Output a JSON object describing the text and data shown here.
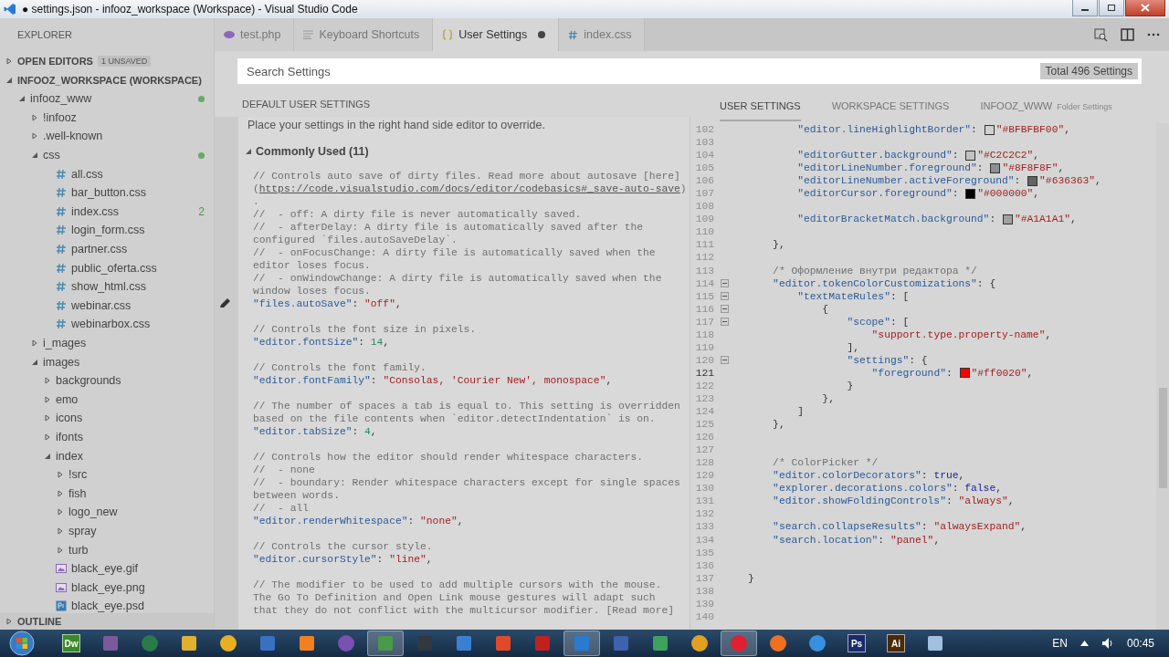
{
  "window": {
    "title": "● settings.json - infooz_workspace (Workspace) - Visual Studio Code"
  },
  "sidebar": {
    "title": "EXPLORER",
    "sections": [
      {
        "label": "OPEN EDITORS",
        "expanded": false,
        "badge": "1 UNSAVED"
      },
      {
        "label": "INFOOZ_WORKSPACE (WORKSPACE)",
        "expanded": true
      }
    ],
    "tree": [
      {
        "label": "infooz_www",
        "kind": "folder",
        "expanded": true,
        "modified": true,
        "children": [
          {
            "label": "!infooz",
            "kind": "folder",
            "expanded": false
          },
          {
            "label": ".well-known",
            "kind": "folder",
            "expanded": false
          },
          {
            "label": "css",
            "kind": "folder",
            "expanded": true,
            "modified": true,
            "children": [
              {
                "label": "all.css",
                "kind": "css"
              },
              {
                "label": "bar_button.css",
                "kind": "css"
              },
              {
                "label": "index.css",
                "kind": "css",
                "badge": "2"
              },
              {
                "label": "login_form.css",
                "kind": "css"
              },
              {
                "label": "partner.css",
                "kind": "css"
              },
              {
                "label": "public_oferta.css",
                "kind": "css"
              },
              {
                "label": "show_html.css",
                "kind": "css"
              },
              {
                "label": "webinar.css",
                "kind": "css"
              },
              {
                "label": "webinarbox.css",
                "kind": "css"
              }
            ]
          },
          {
            "label": "i_mages",
            "kind": "folder",
            "expanded": false
          },
          {
            "label": "images",
            "kind": "folder",
            "expanded": true,
            "children": [
              {
                "label": "backgrounds",
                "kind": "folder",
                "expanded": false
              },
              {
                "label": "emo",
                "kind": "folder",
                "expanded": false
              },
              {
                "label": "icons",
                "kind": "folder",
                "expanded": false
              },
              {
                "label": "ifonts",
                "kind": "folder",
                "expanded": false
              },
              {
                "label": "index",
                "kind": "folder",
                "expanded": true,
                "children": [
                  {
                    "label": "!src",
                    "kind": "folder",
                    "expanded": false
                  },
                  {
                    "label": "fish",
                    "kind": "folder",
                    "expanded": false
                  },
                  {
                    "label": "logo_new",
                    "kind": "folder",
                    "expanded": false
                  },
                  {
                    "label": "spray",
                    "kind": "folder",
                    "expanded": false
                  },
                  {
                    "label": "turb",
                    "kind": "folder",
                    "expanded": false
                  }
                ]
              },
              {
                "label": "black_eye.gif",
                "kind": "image"
              },
              {
                "label": "black_eye.png",
                "kind": "image"
              },
              {
                "label": "black_eye.psd",
                "kind": "psd"
              }
            ]
          }
        ]
      }
    ],
    "footer": {
      "label": "OUTLINE",
      "expanded": false
    }
  },
  "tabs": [
    {
      "label": "test.php",
      "kind": "php",
      "selected": false
    },
    {
      "label": "Keyboard Shortcuts",
      "kind": "shortcuts",
      "selected": false
    },
    {
      "label": "User Settings",
      "kind": "json",
      "selected": true,
      "dirty": true
    },
    {
      "label": "index.css",
      "kind": "css",
      "selected": false
    }
  ],
  "search": {
    "placeholder": "Search Settings",
    "count": "Total 496 Settings"
  },
  "default_pane": {
    "header": "DEFAULT USER SETTINGS",
    "note": "Place your settings in the right hand side editor to override.",
    "group": {
      "label": "Commonly Used (11)",
      "expanded": true
    },
    "blocks": [
      {
        "lines": [
          {
            "tokens": [
              {
                "kind": "comment",
                "text": "// Controls auto save of dirty files. Read more about autosave [here]"
              }
            ]
          },
          {
            "tokens": [
              {
                "kind": "comment",
                "text": "("
              },
              {
                "kind": "link",
                "text": "https://code.visualstudio.com/docs/editor/codebasics#_save-auto-save"
              },
              {
                "kind": "comment",
                "text": ")"
              }
            ]
          },
          {
            "tokens": [
              {
                "kind": "comment",
                "text": "."
              }
            ]
          },
          {
            "tokens": [
              {
                "kind": "comment",
                "text": "//  - off: A dirty file is never automatically saved."
              }
            ]
          },
          {
            "tokens": [
              {
                "kind": "comment",
                "text": "//  - afterDelay: A dirty file is automatically saved after the"
              }
            ]
          },
          {
            "tokens": [
              {
                "kind": "comment",
                "text": "configured `files.autoSaveDelay`."
              }
            ]
          },
          {
            "tokens": [
              {
                "kind": "comment",
                "text": "//  - onFocusChange: A dirty file is automatically saved when the"
              }
            ]
          },
          {
            "tokens": [
              {
                "kind": "comment",
                "text": "editor loses focus."
              }
            ]
          },
          {
            "tokens": [
              {
                "kind": "comment",
                "text": "//  - onWindowChange: A dirty file is automatically saved when the"
              }
            ]
          },
          {
            "tokens": [
              {
                "kind": "comment",
                "text": "window loses focus."
              }
            ]
          },
          {
            "pencil": true,
            "tokens": [
              {
                "kind": "key",
                "text": "\"files.autoSave\""
              },
              {
                "kind": "punct",
                "text": ": "
              },
              {
                "kind": "string",
                "text": "\"off\""
              },
              {
                "kind": "punct",
                "text": ","
              }
            ]
          }
        ]
      },
      {
        "lines": [
          {
            "tokens": [
              {
                "kind": "comment",
                "text": "// Controls the font size in pixels."
              }
            ]
          },
          {
            "tokens": [
              {
                "kind": "key",
                "text": "\"editor.fontSize\""
              },
              {
                "kind": "punct",
                "text": ": "
              },
              {
                "kind": "number",
                "text": "14"
              },
              {
                "kind": "punct",
                "text": ","
              }
            ]
          }
        ]
      },
      {
        "lines": [
          {
            "tokens": [
              {
                "kind": "comment",
                "text": "// Controls the font family."
              }
            ]
          },
          {
            "tokens": [
              {
                "kind": "key",
                "text": "\"editor.fontFamily\""
              },
              {
                "kind": "punct",
                "text": ": "
              },
              {
                "kind": "string",
                "text": "\"Consolas, 'Courier New', monospace\""
              },
              {
                "kind": "punct",
                "text": ","
              }
            ]
          }
        ]
      },
      {
        "lines": [
          {
            "tokens": [
              {
                "kind": "comment",
                "text": "// The number of spaces a tab is equal to. This setting is overridden"
              }
            ]
          },
          {
            "tokens": [
              {
                "kind": "comment",
                "text": "based on the file contents when `editor.detectIndentation` is on."
              }
            ]
          },
          {
            "tokens": [
              {
                "kind": "key",
                "text": "\"editor.tabSize\""
              },
              {
                "kind": "punct",
                "text": ": "
              },
              {
                "kind": "number",
                "text": "4"
              },
              {
                "kind": "punct",
                "text": ","
              }
            ]
          }
        ]
      },
      {
        "lines": [
          {
            "tokens": [
              {
                "kind": "comment",
                "text": "// Controls how the editor should render whitespace characters."
              }
            ]
          },
          {
            "tokens": [
              {
                "kind": "comment",
                "text": "//  - none"
              }
            ]
          },
          {
            "tokens": [
              {
                "kind": "comment",
                "text": "//  - boundary: Render whitespace characters except for single spaces"
              }
            ]
          },
          {
            "tokens": [
              {
                "kind": "comment",
                "text": "between words."
              }
            ]
          },
          {
            "tokens": [
              {
                "kind": "comment",
                "text": "//  - all"
              }
            ]
          },
          {
            "tokens": [
              {
                "kind": "key",
                "text": "\"editor.renderWhitespace\""
              },
              {
                "kind": "punct",
                "text": ": "
              },
              {
                "kind": "string",
                "text": "\"none\""
              },
              {
                "kind": "punct",
                "text": ","
              }
            ]
          }
        ]
      },
      {
        "lines": [
          {
            "tokens": [
              {
                "kind": "comment",
                "text": "// Controls the cursor style."
              }
            ]
          },
          {
            "tokens": [
              {
                "kind": "key",
                "text": "\"editor.cursorStyle\""
              },
              {
                "kind": "punct",
                "text": ": "
              },
              {
                "kind": "string",
                "text": "\"line\""
              },
              {
                "kind": "punct",
                "text": ","
              }
            ]
          }
        ]
      },
      {
        "lines": [
          {
            "tokens": [
              {
                "kind": "comment",
                "text": "// The modifier to be used to add multiple cursors with the mouse."
              }
            ]
          },
          {
            "tokens": [
              {
                "kind": "comment",
                "text": "The Go To Definition and Open Link mouse gestures will adapt such"
              }
            ]
          },
          {
            "tokens": [
              {
                "kind": "comment",
                "text": "that they do not conflict with the multicursor modifier. [Read more]"
              }
            ]
          }
        ]
      }
    ]
  },
  "user_pane": {
    "tabs": [
      {
        "label": "USER SETTINGS",
        "selected": true
      },
      {
        "label": "WORKSPACE SETTINGS",
        "selected": false
      },
      {
        "label": "INFOOZ_WWW",
        "sublabel": "Folder Settings",
        "selected": false
      }
    ],
    "lines": [
      {
        "number": "102",
        "tokens": [
          {
            "kind": "key",
            "text": "        \"editor.lineHighlightBorder\""
          },
          {
            "kind": "punct",
            "text": ": "
          },
          {
            "kind": "swatch",
            "color": "#d0d0d0"
          },
          {
            "kind": "string",
            "text": "\"#BFBFBF00\""
          },
          {
            "kind": "punct",
            "text": ","
          }
        ]
      },
      {
        "number": "103"
      },
      {
        "number": "104",
        "tokens": [
          {
            "kind": "key",
            "text": "        \"editorGutter.background\""
          },
          {
            "kind": "punct",
            "text": ": "
          },
          {
            "kind": "swatch",
            "color": "#c2c2c2"
          },
          {
            "kind": "string",
            "text": "\"#C2C2C2\""
          },
          {
            "kind": "punct",
            "text": ","
          }
        ]
      },
      {
        "number": "105",
        "tokens": [
          {
            "kind": "key",
            "text": "        \"editorLineNumber.foreground\""
          },
          {
            "kind": "punct",
            "text": ": "
          },
          {
            "kind": "swatch",
            "color": "#8f8f8f"
          },
          {
            "kind": "string",
            "text": "\"#8F8F8F\""
          },
          {
            "kind": "punct",
            "text": ","
          }
        ]
      },
      {
        "number": "106",
        "tokens": [
          {
            "kind": "key",
            "text": "        \"editorLineNumber.activeForeground\""
          },
          {
            "kind": "punct",
            "text": ": "
          },
          {
            "kind": "swatch",
            "color": "#636363"
          },
          {
            "kind": "string",
            "text": "\"#636363\""
          },
          {
            "kind": "punct",
            "text": ","
          }
        ]
      },
      {
        "number": "107",
        "tokens": [
          {
            "kind": "key",
            "text": "        \"editorCursor.foreground\""
          },
          {
            "kind": "punct",
            "text": ": "
          },
          {
            "kind": "swatch",
            "color": "#000000"
          },
          {
            "kind": "string",
            "text": "\"#000000\""
          },
          {
            "kind": "punct",
            "text": ","
          }
        ]
      },
      {
        "number": "108"
      },
      {
        "number": "109",
        "tokens": [
          {
            "kind": "key",
            "text": "        \"editorBracketMatch.background\""
          },
          {
            "kind": "punct",
            "text": ": "
          },
          {
            "kind": "swatch",
            "color": "#a1a1a1"
          },
          {
            "kind": "string",
            "text": "\"#A1A1A1\""
          },
          {
            "kind": "punct",
            "text": ","
          }
        ]
      },
      {
        "number": "110"
      },
      {
        "number": "111",
        "tokens": [
          {
            "kind": "punct",
            "text": "    },"
          }
        ]
      },
      {
        "number": "112"
      },
      {
        "number": "113",
        "tokens": [
          {
            "kind": "comment",
            "text": "    /* Оформление внутри редактора */"
          }
        ]
      },
      {
        "number": "114",
        "fold": true,
        "tokens": [
          {
            "kind": "key",
            "text": "    \"editor.tokenColorCustomizations\""
          },
          {
            "kind": "punct",
            "text": ": {"
          }
        ]
      },
      {
        "number": "115",
        "fold": true,
        "tokens": [
          {
            "kind": "key",
            "text": "        \"textMateRules\""
          },
          {
            "kind": "punct",
            "text": ": ["
          }
        ]
      },
      {
        "number": "116",
        "fold": true,
        "tokens": [
          {
            "kind": "punct",
            "text": "            {"
          }
        ]
      },
      {
        "number": "117",
        "fold": true,
        "tokens": [
          {
            "kind": "key",
            "text": "                \"scope\""
          },
          {
            "kind": "punct",
            "text": ": ["
          }
        ]
      },
      {
        "number": "118",
        "tokens": [
          {
            "kind": "string",
            "text": "                    \"support.type.property-name\""
          },
          {
            "kind": "punct",
            "text": ","
          }
        ]
      },
      {
        "number": "119",
        "tokens": [
          {
            "kind": "punct",
            "text": "                ],"
          }
        ]
      },
      {
        "number": "120",
        "fold": true,
        "tokens": [
          {
            "kind": "key",
            "text": "                \"settings\""
          },
          {
            "kind": "punct",
            "text": ": {"
          }
        ]
      },
      {
        "number": "121",
        "active": true,
        "tokens": [
          {
            "kind": "key",
            "text": "                    \"foreground\""
          },
          {
            "kind": "punct",
            "text": ": "
          },
          {
            "kind": "swatch",
            "color": "#ff0000"
          },
          {
            "kind": "string",
            "text": "\"#ff0020\""
          },
          {
            "kind": "punct",
            "text": ","
          }
        ]
      },
      {
        "number": "122",
        "tokens": [
          {
            "kind": "punct",
            "text": "                }"
          }
        ]
      },
      {
        "number": "123",
        "tokens": [
          {
            "kind": "punct",
            "text": "            },"
          }
        ]
      },
      {
        "number": "124",
        "tokens": [
          {
            "kind": "punct",
            "text": "        ]"
          }
        ]
      },
      {
        "number": "125",
        "tokens": [
          {
            "kind": "punct",
            "text": "    },"
          }
        ]
      },
      {
        "number": "126"
      },
      {
        "number": "127"
      },
      {
        "number": "128",
        "tokens": [
          {
            "kind": "comment",
            "text": "    /* ColorPicker */"
          }
        ]
      },
      {
        "number": "129",
        "tokens": [
          {
            "kind": "key",
            "text": "    \"editor.colorDecorators\""
          },
          {
            "kind": "punct",
            "text": ": "
          },
          {
            "kind": "keyword",
            "text": "true"
          },
          {
            "kind": "punct",
            "text": ","
          }
        ]
      },
      {
        "number": "130",
        "tokens": [
          {
            "kind": "key",
            "text": "    \"explorer.decorations.colors\""
          },
          {
            "kind": "punct",
            "text": ": "
          },
          {
            "kind": "keyword",
            "text": "false"
          },
          {
            "kind": "punct",
            "text": ","
          }
        ]
      },
      {
        "number": "131",
        "tokens": [
          {
            "kind": "key",
            "text": "    \"editor.showFoldingControls\""
          },
          {
            "kind": "punct",
            "text": ": "
          },
          {
            "kind": "string",
            "text": "\"always\""
          },
          {
            "kind": "punct",
            "text": ","
          }
        ]
      },
      {
        "number": "132"
      },
      {
        "number": "133",
        "tokens": [
          {
            "kind": "key",
            "text": "    \"search.collapseResults\""
          },
          {
            "kind": "punct",
            "text": ": "
          },
          {
            "kind": "string",
            "text": "\"alwaysExpand\""
          },
          {
            "kind": "punct",
            "text": ","
          }
        ]
      },
      {
        "number": "134",
        "tokens": [
          {
            "kind": "key",
            "text": "    \"search.location\""
          },
          {
            "kind": "punct",
            "text": ": "
          },
          {
            "kind": "string",
            "text": "\"panel\""
          },
          {
            "kind": "punct",
            "text": ","
          }
        ]
      },
      {
        "number": "135"
      },
      {
        "number": "136"
      },
      {
        "number": "137",
        "tokens": [
          {
            "kind": "punct",
            "text": "}"
          }
        ]
      },
      {
        "number": "138"
      },
      {
        "number": "139"
      },
      {
        "number": "140"
      }
    ]
  },
  "taskbar": {
    "items": [
      {
        "kind": "logo",
        "label": "Dw",
        "color": "#3a8a2a"
      },
      {
        "kind": "tile",
        "color": "#7a5a9a"
      },
      {
        "kind": "circle",
        "color": "#2a7a4a"
      },
      {
        "kind": "tile",
        "color": "#e0b030"
      },
      {
        "kind": "circle",
        "color": "#e8b020"
      },
      {
        "kind": "tile",
        "color": "#3a70c0"
      },
      {
        "kind": "tile",
        "color": "#f08020"
      },
      {
        "kind": "circle",
        "color": "#7a50b0"
      },
      {
        "kind": "tile",
        "color": "#4a9a4a",
        "active": true
      },
      {
        "kind": "tile",
        "color": "#303840"
      },
      {
        "kind": "tile",
        "color": "#3a80d0"
      },
      {
        "kind": "tile",
        "color": "#e04a2a"
      },
      {
        "kind": "tile",
        "color": "#c02020"
      },
      {
        "kind": "tile",
        "color": "#2a7ad0",
        "active": true
      },
      {
        "kind": "tile",
        "color": "#4060b0"
      },
      {
        "kind": "tile",
        "color": "#40a060"
      },
      {
        "kind": "circle",
        "color": "#e0a020"
      },
      {
        "kind": "circle",
        "color": "#e02030",
        "active": true
      },
      {
        "kind": "circle",
        "color": "#f07020"
      },
      {
        "kind": "circle",
        "color": "#3a90e0"
      },
      {
        "kind": "logo",
        "label": "Ps",
        "color": "#1a2a6a"
      },
      {
        "kind": "logo",
        "label": "Ai",
        "color": "#4a2a0a"
      },
      {
        "kind": "tile",
        "color": "#a0c0e0"
      }
    ],
    "language": "EN",
    "clock": "00:45"
  }
}
